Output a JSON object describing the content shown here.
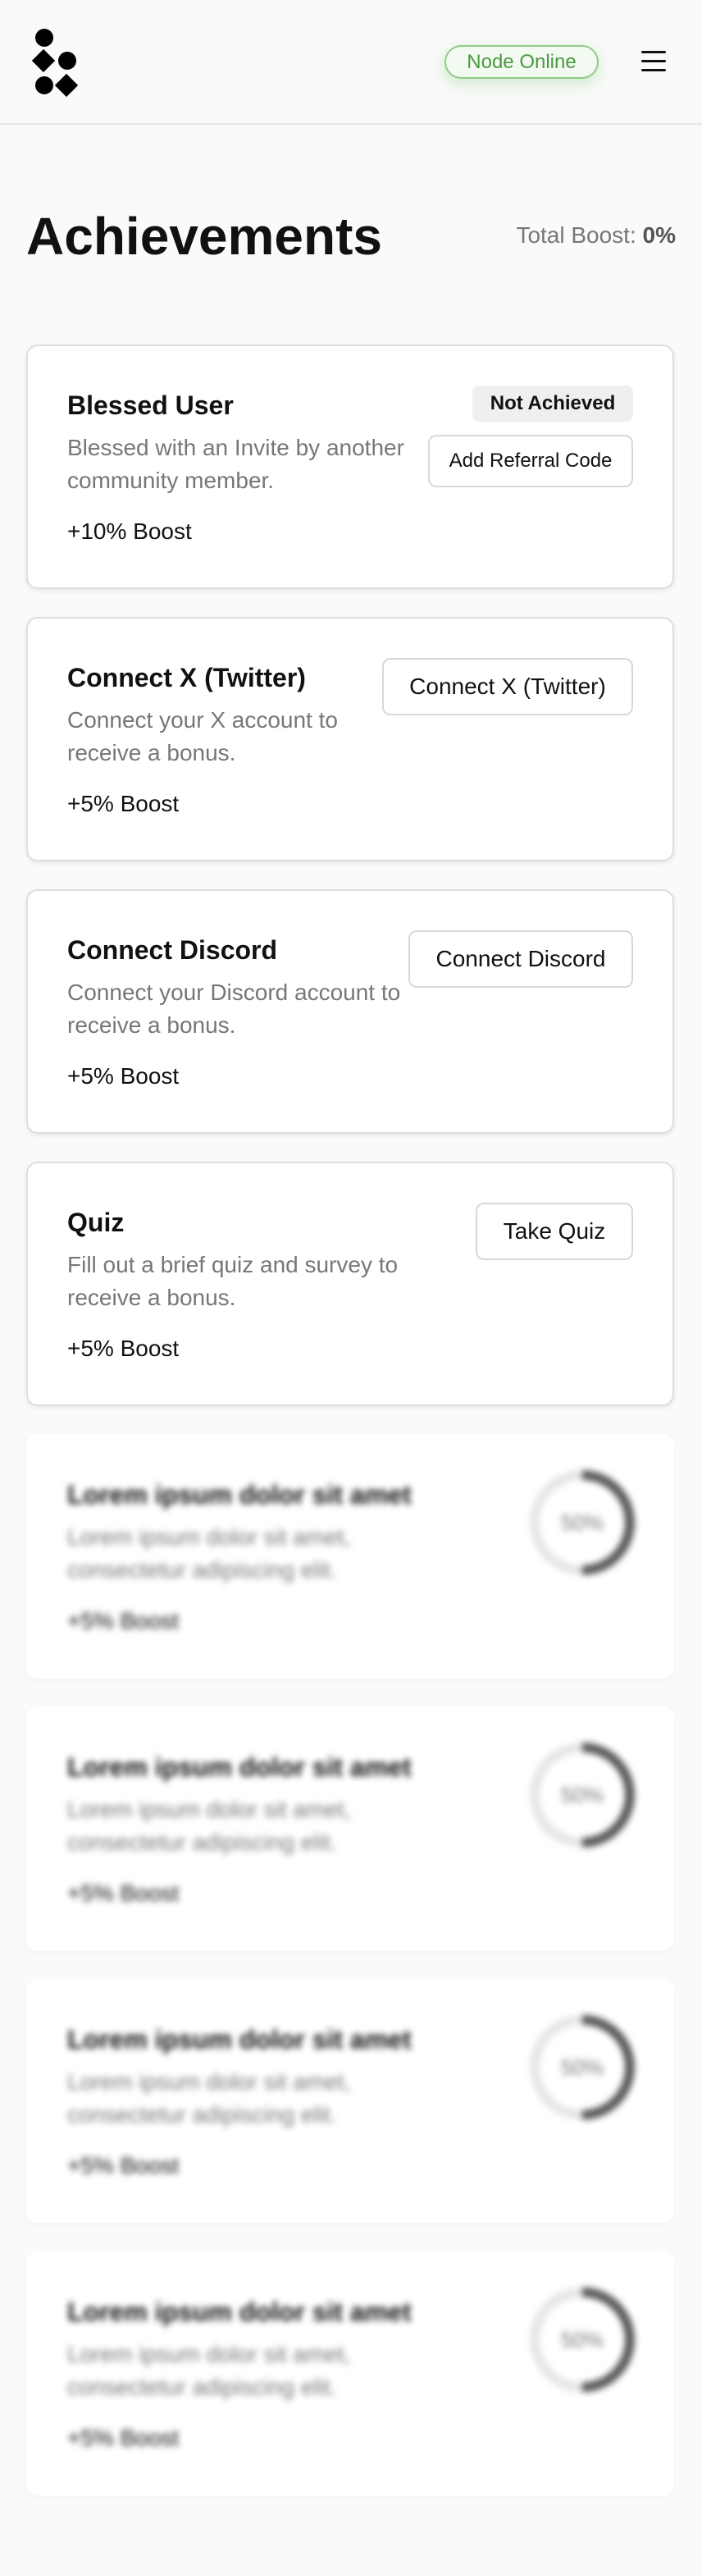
{
  "header": {
    "logo_name": "logo-icon",
    "status_label": "Node Online",
    "menu_icon": "menu-icon",
    "status_color": "#4a9a42"
  },
  "page": {
    "title": "Achievements",
    "total_boost_label": "Total Boost: ",
    "total_boost_value": "0%"
  },
  "achievements": [
    {
      "title": "Blessed User",
      "description": "Blessed with an Invite by another community member.",
      "boost": "+10% Boost",
      "status": "Not Achieved",
      "action": "Add Referral Code"
    },
    {
      "title": "Connect X (Twitter)",
      "description": "Connect your X account to receive a bonus.",
      "boost": "+5% Boost",
      "action": "Connect X (Twitter)"
    },
    {
      "title": "Connect Discord",
      "description": "Connect your Discord account to receive a bonus.",
      "boost": "+5% Boost",
      "action": "Connect Discord"
    },
    {
      "title": "Quiz",
      "description": "Fill out a brief quiz and survey to receive a bonus.",
      "boost": "+5% Boost",
      "action": "Take Quiz"
    }
  ],
  "locked": [
    {
      "title": "Lorem ipsum dolor sit amet",
      "description": "Lorem ipsum dolor sit amet, consectetur adipiscing elit.",
      "boost": "+5% Boost",
      "progress_label": "50%",
      "progress": 0.5
    },
    {
      "title": "Lorem ipsum dolor sit amet",
      "description": "Lorem ipsum dolor sit amet, consectetur adipiscing elit.",
      "boost": "+5% Boost",
      "progress_label": "50%",
      "progress": 0.5
    },
    {
      "title": "Lorem ipsum dolor sit amet",
      "description": "Lorem ipsum dolor sit amet, consectetur adipiscing elit.",
      "boost": "+5% Boost",
      "progress_label": "50%",
      "progress": 0.5
    },
    {
      "title": "Lorem ipsum dolor sit amet",
      "description": "Lorem ipsum dolor sit amet, consectetur adipiscing elit.",
      "boost": "+5% Boost",
      "progress_label": "50%",
      "progress": 0.5
    }
  ]
}
